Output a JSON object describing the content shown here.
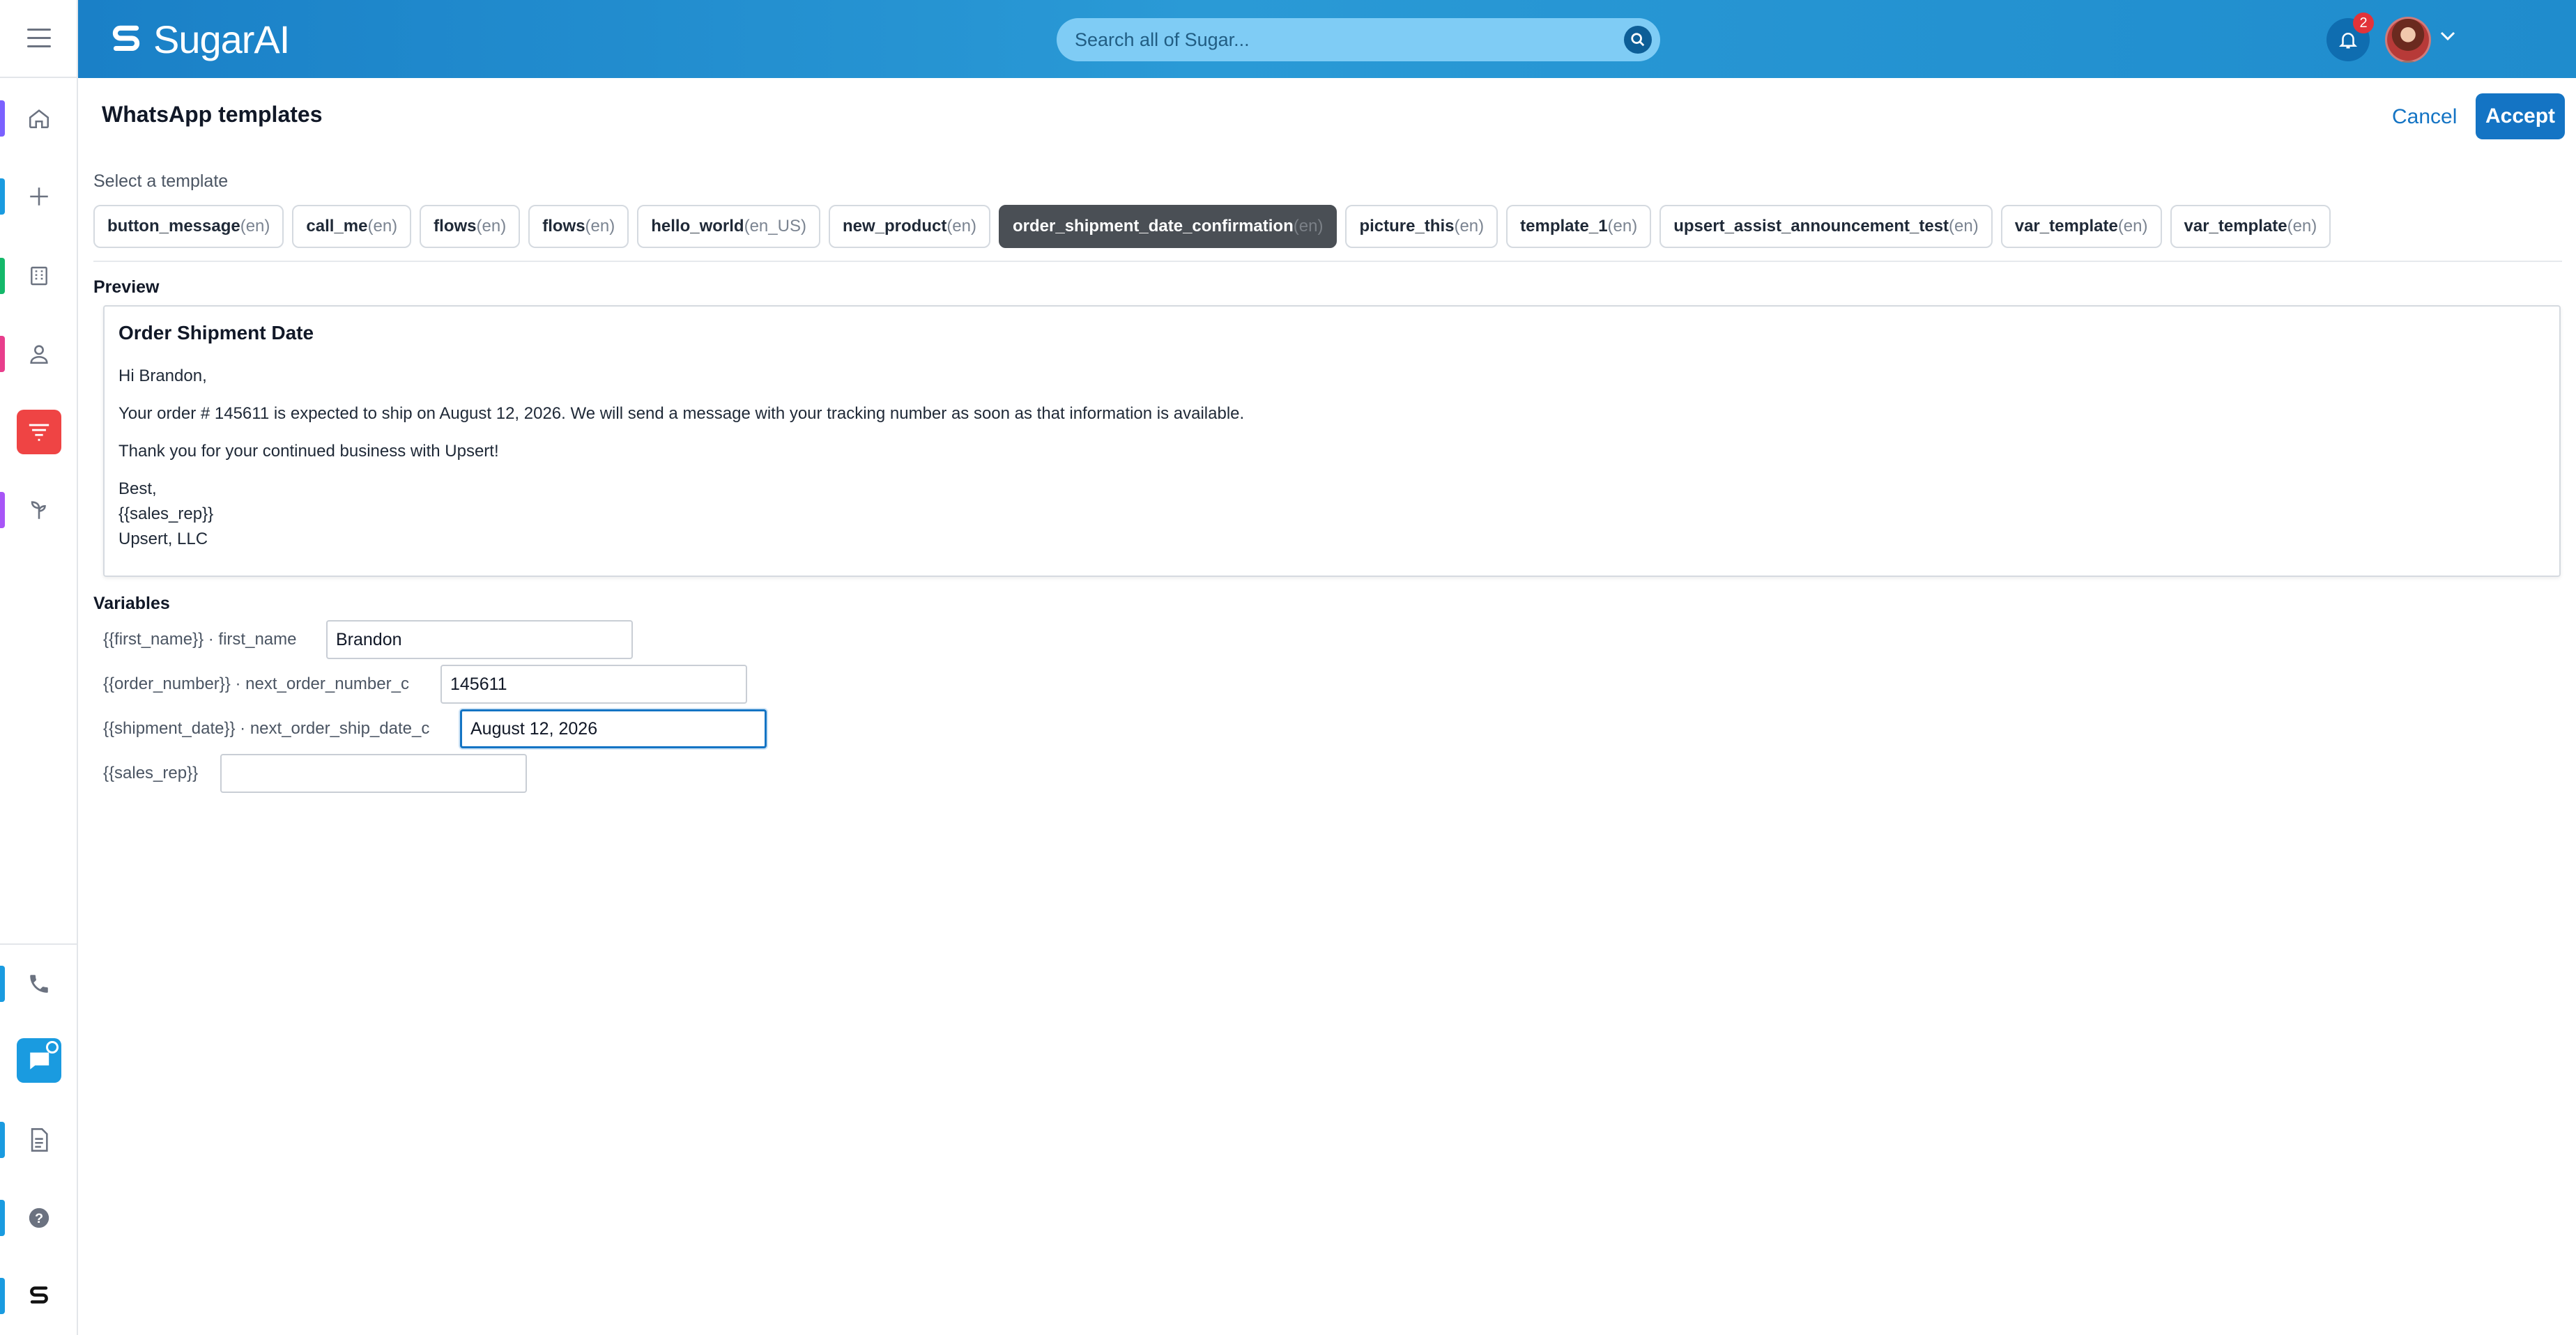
{
  "app": {
    "name": "SugarAI"
  },
  "search": {
    "placeholder": "Search all of Sugar..."
  },
  "notifications": {
    "count": "2"
  },
  "rail": {
    "items": [
      {
        "name": "home",
        "color": "#7b61ff"
      },
      {
        "name": "create",
        "color": "#1a9be0"
      },
      {
        "name": "accounts",
        "color": "#14b86a"
      },
      {
        "name": "contacts",
        "color": "#e83e8c"
      },
      {
        "name": "leads",
        "color": "#ef4444"
      },
      {
        "name": "opportunities",
        "color": "#a855f7"
      },
      {
        "name": "calls",
        "color": "#1a9be0"
      },
      {
        "name": "messages",
        "color": "#1a9be0"
      },
      {
        "name": "documents",
        "color": "#1a9be0"
      },
      {
        "name": "help",
        "color": "#1a9be0"
      },
      {
        "name": "sugar",
        "color": "#1a9be0"
      }
    ]
  },
  "page": {
    "title": "WhatsApp templates",
    "cancel_label": "Cancel",
    "accept_label": "Accept",
    "select_label": "Select a template",
    "preview_label": "Preview",
    "variables_label": "Variables"
  },
  "templates": [
    {
      "name": "button_message",
      "locale": "(en)"
    },
    {
      "name": "call_me",
      "locale": "(en)"
    },
    {
      "name": "flows",
      "locale": "(en)"
    },
    {
      "name": "flows",
      "locale": "(en)"
    },
    {
      "name": "hello_world",
      "locale": "(en_US)"
    },
    {
      "name": "new_product",
      "locale": "(en)"
    },
    {
      "name": "order_shipment_date_confirmation",
      "locale": "(en)"
    },
    {
      "name": "picture_this",
      "locale": "(en)"
    },
    {
      "name": "template_1",
      "locale": "(en)"
    },
    {
      "name": "upsert_assist_announcement_test",
      "locale": "(en)"
    },
    {
      "name": "var_template",
      "locale": "(en)"
    },
    {
      "name": "var_template",
      "locale": "(en)"
    }
  ],
  "selected_template_index": 6,
  "preview": {
    "title": "Order Shipment Date",
    "greeting": "Hi Brandon,",
    "body1": "Your order # 145611 is expected to ship on August 12, 2026. We will send a message with your tracking number as soon as that information is available.",
    "body2": "Thank you for your continued business with Upsert!",
    "sign1": "Best,",
    "sign2": "{{sales_rep}}",
    "sign3": "Upsert, LLC"
  },
  "variables": [
    {
      "label": "{{first_name}} · first_name",
      "value": "Brandon"
    },
    {
      "label": "{{order_number}} · next_order_number_c",
      "value": "145611"
    },
    {
      "label": "{{shipment_date}} · next_order_ship_date_c",
      "value": "August 12, 2026"
    },
    {
      "label": "{{sales_rep}}",
      "value": ""
    }
  ],
  "colors": {
    "header": "#1f8ccd",
    "accent": "#1474c4",
    "chip_active": "#4a4f55"
  }
}
